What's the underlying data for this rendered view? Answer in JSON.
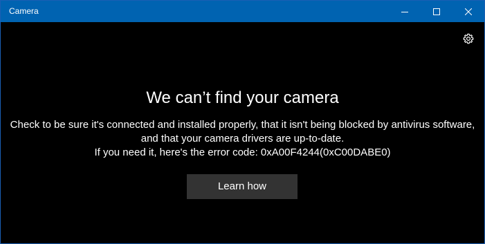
{
  "window": {
    "title": "Camera",
    "accent_color": "#0063b1"
  },
  "titlebar_buttons": {
    "minimize_icon": "minimize-icon",
    "maximize_icon": "maximize-icon",
    "close_icon": "close-icon"
  },
  "settings": {
    "icon": "gear-icon"
  },
  "error": {
    "heading": "We can’t find your camera",
    "line1": "Check to be sure it's connected and installed properly, that it isn't being blocked by antivirus software,",
    "line2": "and that your camera drivers are up-to-date.",
    "line3": "If you need it, here's the error code: 0xA00F4244(0xC00DABE0)"
  },
  "actions": {
    "learn_how_label": "Learn how",
    "button_color": "#333333"
  }
}
